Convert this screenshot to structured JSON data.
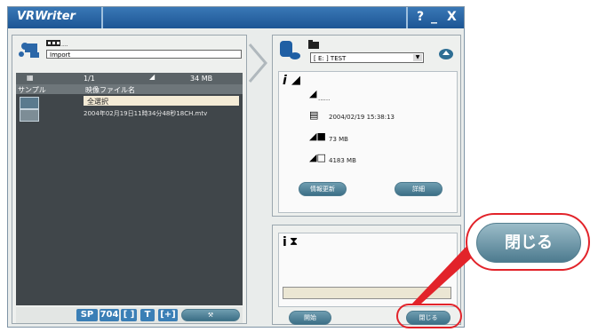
{
  "window": {
    "title": "VRWriter",
    "help": "?",
    "minimize": "_",
    "close": "X"
  },
  "left": {
    "source_field": "Import",
    "count": "1/1",
    "size": "34 MB",
    "col_sample": "サンプル",
    "col_filename": "映像ファイル名",
    "select_all": "全選択",
    "file_name": "2004年02月19日11時34分48秒18CH.mtv",
    "bottom_sp": "SP",
    "bottom_num": "704",
    "bottom_t": "T"
  },
  "right": {
    "drive_select": "[ E: ] TEST",
    "date": "2004/02/19 15:38:13",
    "used": "73 MB",
    "free": "4183 MB",
    "refresh_button": "情報更新",
    "detail_button": "詳細",
    "start_button": "開始",
    "close_button": "閉じる"
  },
  "callout": {
    "label": "閉じる"
  },
  "colors": {
    "titlebar": "#1c5594",
    "highlight": "#e2232a",
    "pill": "#3c6f86"
  }
}
